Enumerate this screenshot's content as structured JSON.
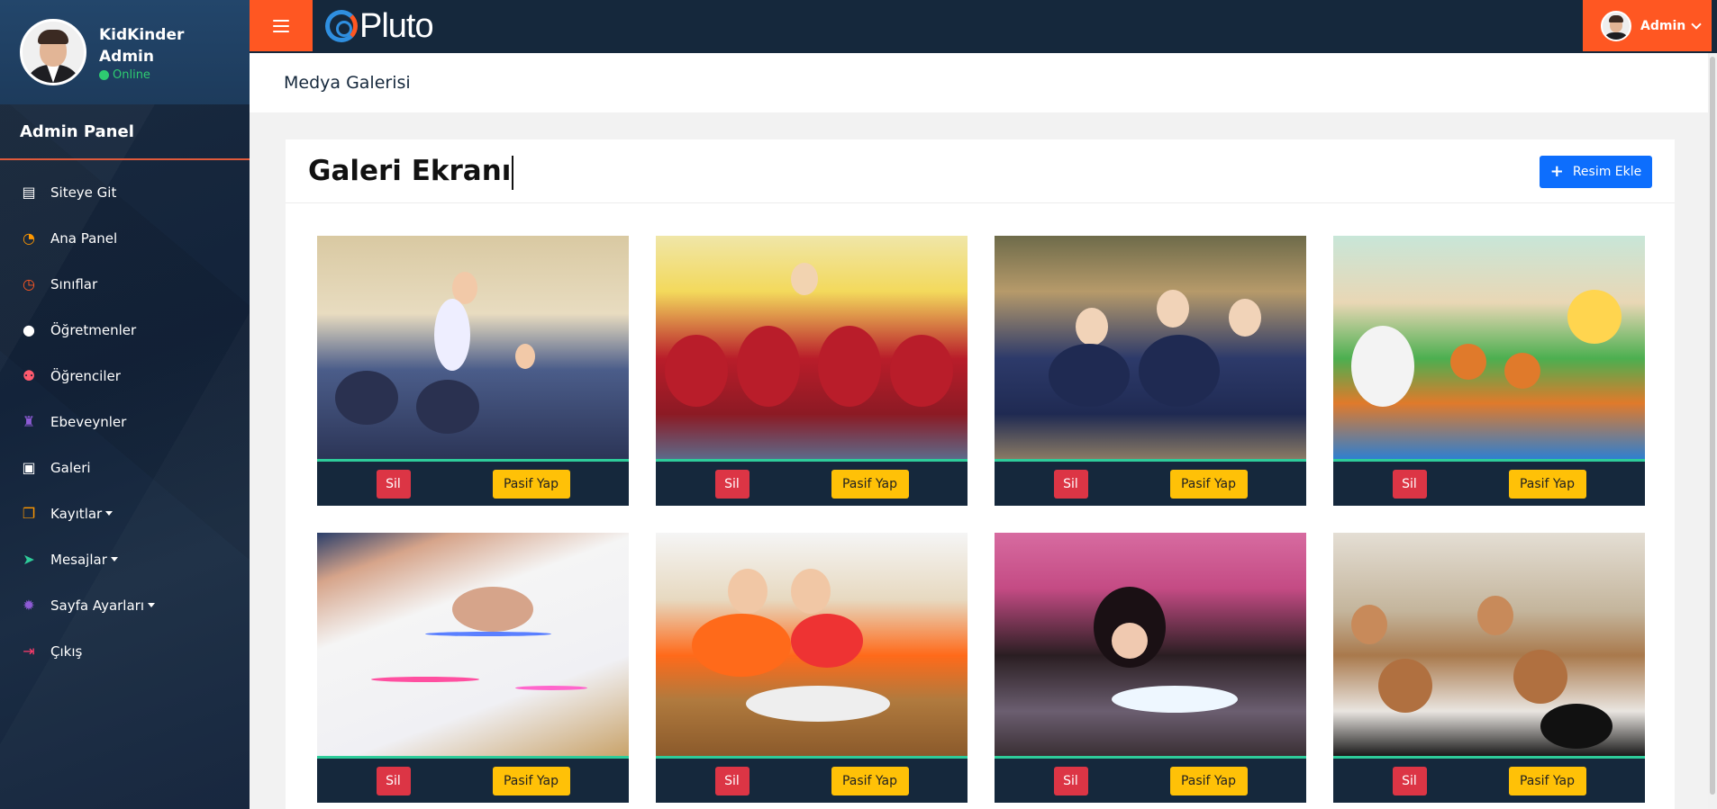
{
  "sidebar": {
    "profile": {
      "name_line1": "KidKinder",
      "name_line2": "Admin",
      "status": "Online"
    },
    "panel_title": "Admin Panel",
    "items": [
      {
        "label": "Siteye Git",
        "icon": "file-icon",
        "color": "#ffffff",
        "dropdown": false
      },
      {
        "label": "Ana Panel",
        "icon": "dashboard-gauge-icon",
        "color": "#ff9800",
        "dropdown": false
      },
      {
        "label": "Sınıflar",
        "icon": "clock-icon",
        "color": "#ff5722",
        "dropdown": false
      },
      {
        "label": "Öğretmenler",
        "icon": "user-icon",
        "color": "#ffffff",
        "dropdown": false
      },
      {
        "label": "Öğrenciler",
        "icon": "users-icon",
        "color": "#ff5a6e",
        "dropdown": false
      },
      {
        "label": "Ebeveynler",
        "icon": "user-lock-icon",
        "color": "#8e5bd6",
        "dropdown": false
      },
      {
        "label": "Galeri",
        "icon": "image-icon",
        "color": "#ffffff",
        "dropdown": false
      },
      {
        "label": "Kayıtlar",
        "icon": "clone-icon",
        "color": "#ff9800",
        "dropdown": true
      },
      {
        "label": "Mesajlar",
        "icon": "paper-plane-icon",
        "color": "#2ecc9a",
        "dropdown": true
      },
      {
        "label": "Sayfa Ayarları",
        "icon": "gear-icon",
        "color": "#8e5bd6",
        "dropdown": true
      },
      {
        "label": "Çıkış",
        "icon": "sign-out-icon",
        "color": "#ff3b6b",
        "dropdown": false
      }
    ]
  },
  "topbar": {
    "logo_text": "Pluto",
    "user_name": "Admin"
  },
  "header": {
    "page_title": "Medya Galerisi"
  },
  "gallery": {
    "title": "Galeri Ekranı",
    "add_button": "Resim Ekle",
    "delete_label": "Sil",
    "deactivate_label": "Pasif Yap",
    "photos": [
      {
        "scene": "s1",
        "alt": "teacher-with-students-classroom"
      },
      {
        "scene": "s2",
        "alt": "children-sitting-on-floor-with-teacher"
      },
      {
        "scene": "s3",
        "alt": "students-at-desks"
      },
      {
        "scene": "s4",
        "alt": "colorful-classroom-interior"
      },
      {
        "scene": "s5",
        "alt": "child-drawing-with-markers"
      },
      {
        "scene": "s6",
        "alt": "two-boys-reading-book"
      },
      {
        "scene": "s7",
        "alt": "girl-coloring-on-floor"
      },
      {
        "scene": "s8",
        "alt": "children-playing-guitars"
      }
    ]
  },
  "colors": {
    "accent": "#ff5722",
    "primary": "#0d6efd",
    "danger": "#dc3545",
    "warning": "#ffc107",
    "dark": "#15283c",
    "online": "#2ecc71"
  }
}
